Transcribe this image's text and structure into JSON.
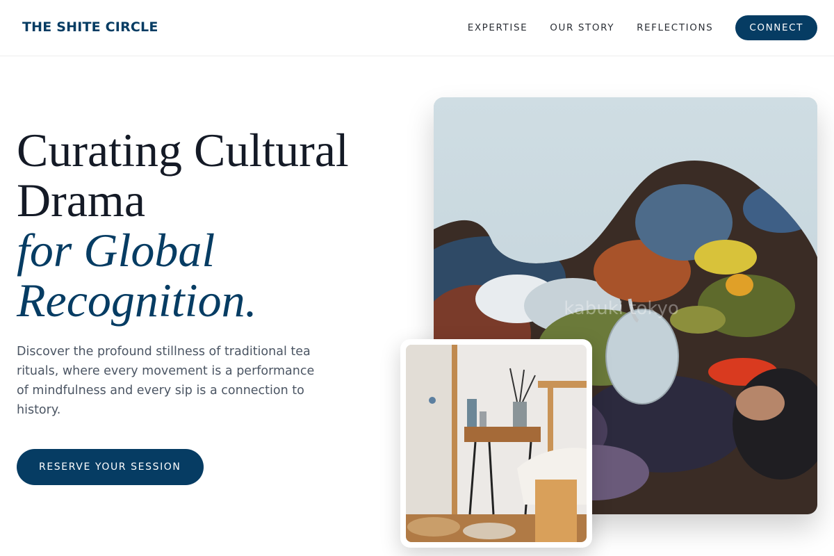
{
  "header": {
    "brand": "THE SHITE CIRCLE",
    "nav": [
      "EXPERTISE",
      "OUR STORY",
      "REFLECTIONS"
    ],
    "cta": "CONNECT"
  },
  "hero": {
    "headline_line1": "Curating Cultural",
    "headline_line2": "Drama",
    "headline_accent_line1": "for Global",
    "headline_accent_line2": "Recognition.",
    "description": "Discover the profound stillness of traditional tea rituals, where every movement is a performance of mindfulness and every sip is a connection to history.",
    "cta": "RESERVE YOUR SESSION"
  },
  "images": {
    "main_watermark": "kabuki tokyo"
  },
  "colors": {
    "accent": "#063c63",
    "headline": "#141a26",
    "body_text": "#4b5563"
  }
}
